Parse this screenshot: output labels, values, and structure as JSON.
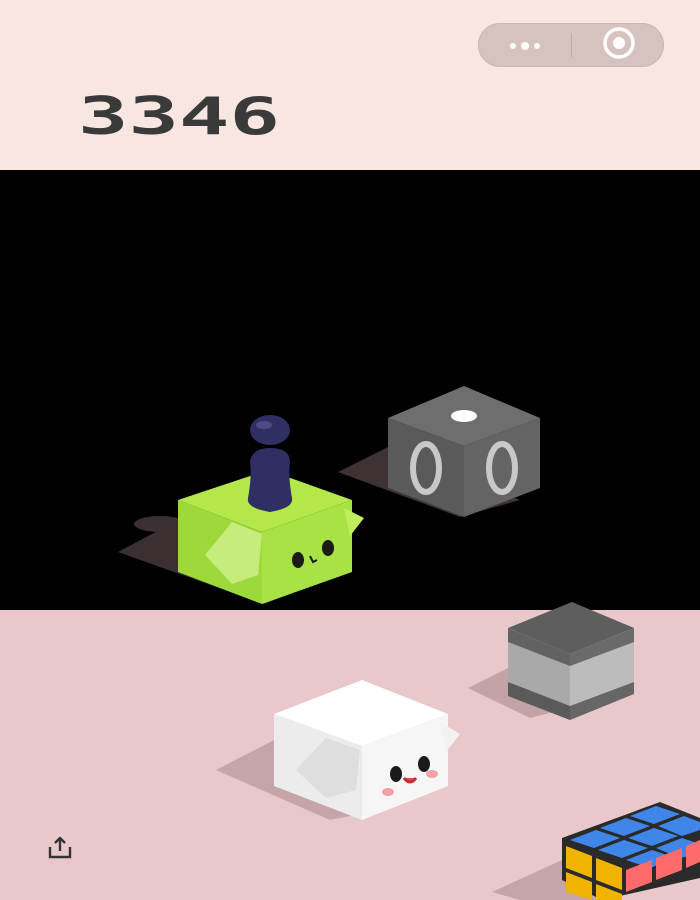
{
  "game": {
    "score": "3346",
    "capsule": {
      "more_icon": "more-dots-icon",
      "target_icon": "target-icon"
    },
    "share_icon": "share-icon"
  },
  "colors": {
    "top_bg": "#f8e6e1",
    "bottom_bg": "#e9c8cb",
    "score_color": "#3a3a3a",
    "player_cube": "#b4e84a",
    "player_piece": "#2f2f63"
  }
}
